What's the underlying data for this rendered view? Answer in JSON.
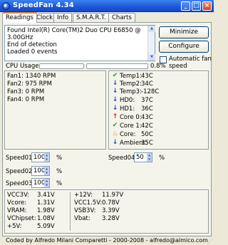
{
  "window": {
    "title": "SpeedFan 4.34",
    "controls": [
      "_",
      "□",
      "×"
    ]
  },
  "tabs": [
    "Readings",
    "Clock",
    "Info",
    "S.M.A.R.T.",
    "Charts"
  ],
  "log": {
    "lines": [
      "Found Intel(R) Core(TM)2 Duo CPU E6850 @ 3.00GHz",
      "End of detection",
      "Loaded 0 events"
    ]
  },
  "buttons": {
    "minimize": "Minimize",
    "configure": "Configure"
  },
  "auto_fan": {
    "label_line1": "Automatic fan",
    "label_line2": "speed",
    "checked": false
  },
  "cpu_usage": {
    "label": "CPU Usage",
    "value": "0.8%",
    "percent": 0.8
  },
  "fans": [
    "Fan1: 1340 RPM",
    "Fan2: 975 RPM",
    "Fan3: 0 RPM",
    "Fan4: 0 RPM"
  ],
  "temps": [
    {
      "name": "Temp1:",
      "value": "43C",
      "icon": "check-icon"
    },
    {
      "name": "Temp2:",
      "value": "34C",
      "icon": "down-arrow-icon"
    },
    {
      "name": "Temp3:",
      "value": "-128C",
      "icon": "down-arrow-icon"
    },
    {
      "name": "HD0:",
      "value": "37C",
      "icon": "down-arrow-icon"
    },
    {
      "name": "HD1:",
      "value": "36C",
      "icon": "down-arrow-icon"
    },
    {
      "name": "Core 0:",
      "value": "43C",
      "icon": "up-arrow-icon"
    },
    {
      "name": "Core 1:",
      "value": "42C",
      "icon": "check-icon"
    },
    {
      "name": "Core:",
      "value": "50C",
      "icon": "flame-icon"
    },
    {
      "name": "Ambient:",
      "value": "35C",
      "icon": "down-arrow-icon"
    }
  ],
  "speeds": [
    {
      "label": "Speed01:",
      "value": "100",
      "unit": "%"
    },
    {
      "label": "Speed02:",
      "value": "100",
      "unit": "%"
    },
    {
      "label": "Speed03:",
      "value": "100",
      "unit": "%"
    },
    {
      "label": "Speed04:",
      "value": "50",
      "unit": "%"
    }
  ],
  "voltages_left": [
    {
      "name": "VCC3V:",
      "value": "3.41V"
    },
    {
      "name": "Vcore:",
      "value": "1.31V"
    },
    {
      "name": "VRAM:",
      "value": "1.98V"
    },
    {
      "name": "VChipset:",
      "value": "1.08V"
    },
    {
      "name": "+5V:",
      "value": "5.09V"
    }
  ],
  "voltages_right": [
    {
      "name": "+12V:",
      "value": "11.97V"
    },
    {
      "name": "VCC1.5V:",
      "value": "0.78V"
    },
    {
      "name": "VSB3V:",
      "value": "3.39V"
    },
    {
      "name": "Vbat:",
      "value": "3.28V"
    }
  ],
  "status_bar": "Coded by Alfredo Milani Comparetti - 2000-2008 - alfredo@almico.com",
  "colors": {
    "title_bar": "#1d56d8",
    "tab_highlight": "#e68b2c",
    "up_arrow": "#d02020",
    "down_arrow": "#1e3fd0",
    "check": "#18a018",
    "flame": "#f07010"
  }
}
